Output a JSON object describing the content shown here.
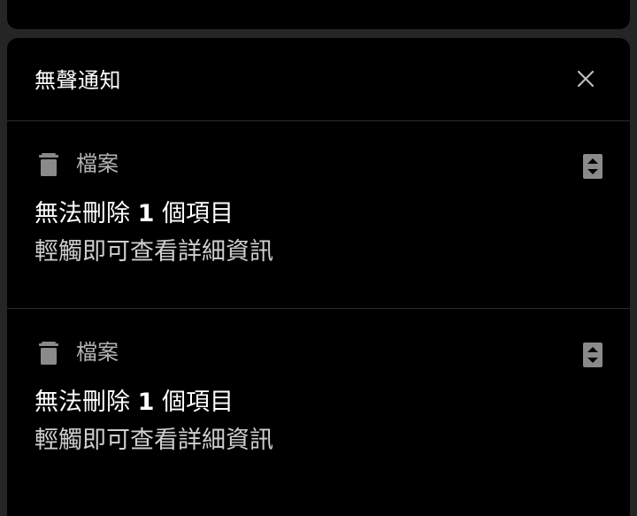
{
  "panel": {
    "title": "無聲通知",
    "close_icon": "close-icon"
  },
  "notifications": [
    {
      "app_icon": "trash-icon",
      "app_name": "檔案",
      "title_prefix": "無法刪除",
      "title_count": "1",
      "title_suffix": "個項目",
      "text": "輕觸即可查看詳細資訊",
      "expand_icon": "expand-collapse-icon"
    },
    {
      "app_icon": "trash-icon",
      "app_name": "檔案",
      "title_prefix": "無法刪除",
      "title_count": "1",
      "title_suffix": "個項目",
      "text": "輕觸即可查看詳細資訊",
      "expand_icon": "expand-collapse-icon"
    }
  ],
  "colors": {
    "background": "#252525",
    "panel": "#000000",
    "divider": "#2c2c2c",
    "secondary_text": "#b3b3b3",
    "icon": "#8a8a8a"
  }
}
